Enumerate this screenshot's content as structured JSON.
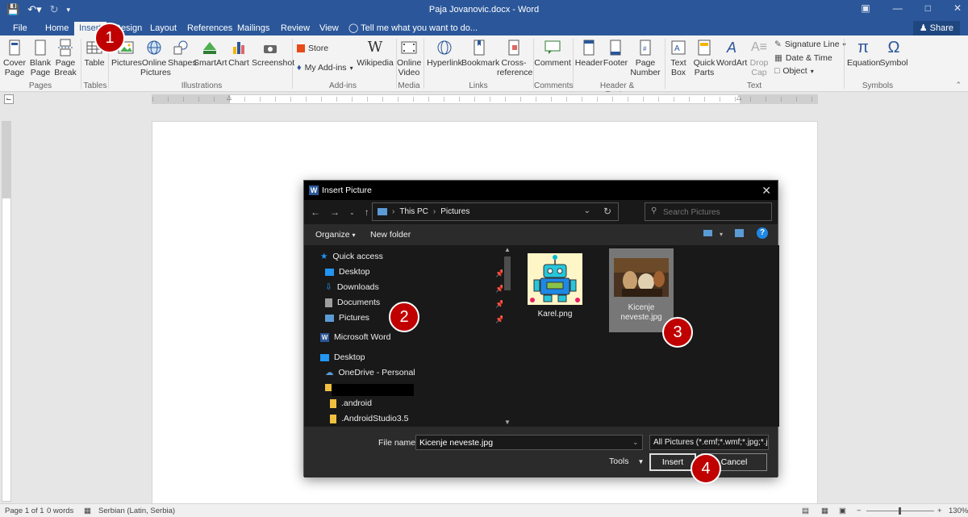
{
  "titlebar": {
    "document_title": "Paja Jovanovic.docx - Word"
  },
  "tabs": [
    {
      "label": "File"
    },
    {
      "label": "Home"
    },
    {
      "label": "Insert"
    },
    {
      "label": "Design"
    },
    {
      "label": "Layout"
    },
    {
      "label": "References"
    },
    {
      "label": "Mailings"
    },
    {
      "label": "Review"
    },
    {
      "label": "View"
    }
  ],
  "tellme": "Tell me what you want to do...",
  "share": "Share",
  "ribbon": {
    "cover_page": "Cover Page",
    "blank_page": "Blank Page",
    "page_break": "Page Break",
    "pages": "Pages",
    "table": "Table",
    "tables": "Tables",
    "pictures": "Pictures",
    "online_pictures": "Online Pictures",
    "shapes": "Shapes",
    "smartart": "SmartArt",
    "chart": "Chart",
    "screenshot": "Screenshot",
    "illustrations": "Illustrations",
    "store": "Store",
    "my_addins": "My Add-ins",
    "wikipedia": "Wikipedia",
    "addins": "Add-ins",
    "online_video": "Online Video",
    "media": "Media",
    "hyperlink": "Hyperlink",
    "bookmark": "Bookmark",
    "cross_reference": "Cross-reference",
    "links": "Links",
    "comment": "Comment",
    "comments": "Comments",
    "header": "Header",
    "footer": "Footer",
    "page_number": "Page Number",
    "header_footer": "Header & Footer",
    "text_box": "Text Box",
    "quick_parts": "Quick Parts",
    "wordart": "WordArt",
    "drop_cap": "Drop Cap",
    "signature_line": "Signature Line",
    "date_time": "Date & Time",
    "object": "Object",
    "text": "Text",
    "equation": "Equation",
    "symbol": "Symbol",
    "symbols": "Symbols"
  },
  "dialog": {
    "title": "Insert Picture",
    "breadcrumb": [
      "This PC",
      "Pictures"
    ],
    "search_placeholder": "Search Pictures",
    "organize": "Organize",
    "new_folder": "New folder",
    "nav": {
      "quick_access": "Quick access",
      "desktop": "Desktop",
      "downloads": "Downloads",
      "documents": "Documents",
      "pictures": "Pictures",
      "microsoft_word": "Microsoft Word",
      "desktop2": "Desktop",
      "onedrive": "OneDrive - Personal",
      "android": ".android",
      "android_studio": ".AndroidStudio3.5"
    },
    "files": [
      {
        "name": "Karel.png"
      },
      {
        "name": "Kicenje neveste.jpg"
      }
    ],
    "file_name_label": "File name:",
    "file_name_value": "Kicenje neveste.jpg",
    "filter": "All Pictures (*.emf;*.wmf;*.jpg;*.j",
    "tools": "Tools",
    "insert": "Insert",
    "cancel": "Cancel"
  },
  "badges": [
    "1",
    "2",
    "3",
    "4"
  ],
  "status": {
    "page": "Page 1 of 1",
    "words": "0 words",
    "language": "Serbian (Latin, Serbia)",
    "zoom": "130%"
  },
  "colors": {
    "word_blue": "#2b579a",
    "badge_red": "#c00000"
  }
}
